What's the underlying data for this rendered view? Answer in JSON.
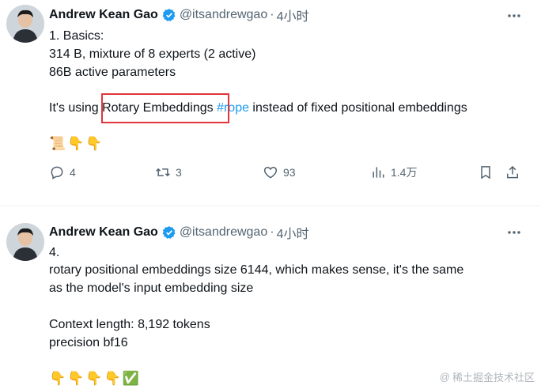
{
  "tweets": [
    {
      "author": "Andrew Kean Gao",
      "handle": "@itsandrewgao",
      "separator": "·",
      "time": "4小时",
      "lines": [
        "1. Basics:",
        "314 B, mixture of 8 experts (2 active)",
        "86B active parameters"
      ],
      "rope_line": {
        "before": "It's using ",
        "highlight": "Rotary Embeddings",
        "hashtag": "#rope",
        "after": " instead of fixed positional embeddings"
      },
      "emojis": [
        "📜",
        "👇",
        "👇"
      ],
      "actions": {
        "replies": "4",
        "reposts": "3",
        "likes": "93",
        "views": "1.4万"
      }
    },
    {
      "author": "Andrew Kean Gao",
      "handle": "@itsandrewgao",
      "separator": "·",
      "time": "4小时",
      "lines": [
        "4.",
        "rotary positional embeddings size 6144, which makes sense, it's the same",
        "as the model's input embedding size",
        "",
        "Context length: 8,192 tokens",
        "precision bf16"
      ],
      "emojis": [
        "👇",
        "👇",
        "👇",
        "👇",
        "✅"
      ]
    }
  ],
  "watermark": "稀土掘金技术社区",
  "colors": {
    "link": "#1d9bf0",
    "muted": "#536471",
    "verified": "#1d9bf0",
    "highlight_box": "#e0353a"
  }
}
